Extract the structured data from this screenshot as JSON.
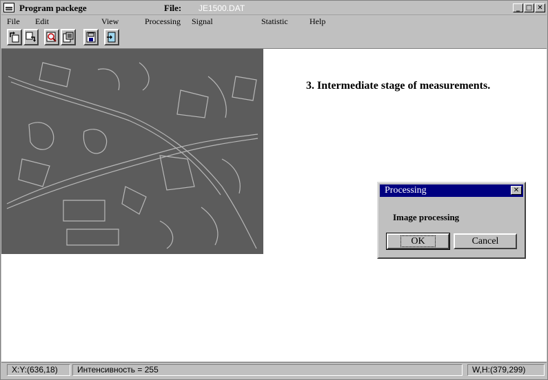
{
  "window": {
    "title": "Program packege",
    "file_label": "File:",
    "file_name": "JE1500.DAT",
    "controls": {
      "minimize": "_",
      "maximize": "□",
      "close": "✕"
    }
  },
  "menu": [
    "File",
    "Edit",
    "View",
    "Processing",
    "Signal",
    "Statistic",
    "Help"
  ],
  "toolbar": {
    "icons": [
      "import-icon",
      "export-icon",
      "zoom-icon",
      "report-icon",
      "save-icon",
      "exit-icon"
    ]
  },
  "content": {
    "heading": "3. Intermediate stage of measurements."
  },
  "dialog": {
    "title": "Processing",
    "close": "✕",
    "message": "Image processing",
    "ok": "OK",
    "cancel": "Cancel"
  },
  "statusbar": {
    "xy": "X:Y:(636,18)",
    "intensity": "Интенсивность = 255",
    "wh": "W,H:(379,299)"
  }
}
